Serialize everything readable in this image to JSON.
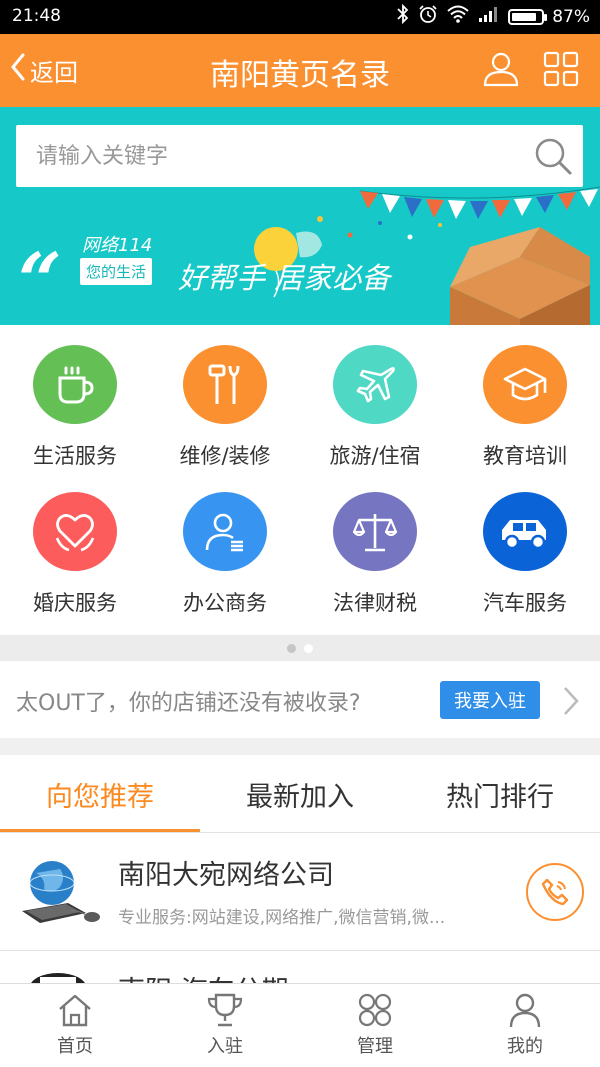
{
  "status_bar": {
    "time": "21:48",
    "battery": "87%",
    "battery_level": 0.87
  },
  "nav": {
    "back_label": "返回",
    "title": "南阳黄页名录",
    "user_icon": "user-icon",
    "grid_icon": "grid-icon"
  },
  "search": {
    "placeholder": "请输入关键字",
    "value": ""
  },
  "banner": {
    "brand": "网络114",
    "tag": "您的生活",
    "slogan": "好帮手 居家必备"
  },
  "categories": [
    {
      "label": "生活服务",
      "icon": "coffee-cup-icon",
      "color": "#64c055"
    },
    {
      "label": "维修/装修",
      "icon": "tools-icon",
      "color": "#fb9030"
    },
    {
      "label": "旅游/住宿",
      "icon": "airplane-icon",
      "color": "#4fd8c4"
    },
    {
      "label": "教育培训",
      "icon": "graduation-cap-icon",
      "color": "#fb9030"
    },
    {
      "label": "婚庆服务",
      "icon": "heart-icon",
      "color": "#fd5c5c"
    },
    {
      "label": "办公商务",
      "icon": "person-card-icon",
      "color": "#3794f0"
    },
    {
      "label": "法律财税",
      "icon": "scales-icon",
      "color": "#7575c2"
    },
    {
      "label": "汽车服务",
      "icon": "car-icon",
      "color": "#0b63d8"
    }
  ],
  "pager": {
    "pages": 2,
    "current": 1
  },
  "promo": {
    "text": "太OUT了，你的店铺还没有被收录?",
    "button": "我要入驻"
  },
  "tabs": [
    {
      "label": "向您推荐",
      "active": true
    },
    {
      "label": "最新加入",
      "active": false
    },
    {
      "label": "热门排行",
      "active": false
    }
  ],
  "list": [
    {
      "name": "南阳大宛网络公司",
      "desc": "专业服务:网站建设,网络推广,微信营销,微...",
      "thumb": "globe-computer-thumb",
      "action_icon": "phone-icon"
    },
    {
      "name": "南阳 汽车分期",
      "thumb": "logo-thumb"
    }
  ],
  "bottom_tabs": [
    {
      "label": "首页",
      "icon": "home-icon"
    },
    {
      "label": "入驻",
      "icon": "trophy-icon"
    },
    {
      "label": "管理",
      "icon": "manage-grid-icon"
    },
    {
      "label": "我的",
      "icon": "profile-icon"
    }
  ],
  "colors": {
    "accent": "#fb9030",
    "banner": "#17c8c8",
    "promo_button": "#2f8fe8"
  }
}
